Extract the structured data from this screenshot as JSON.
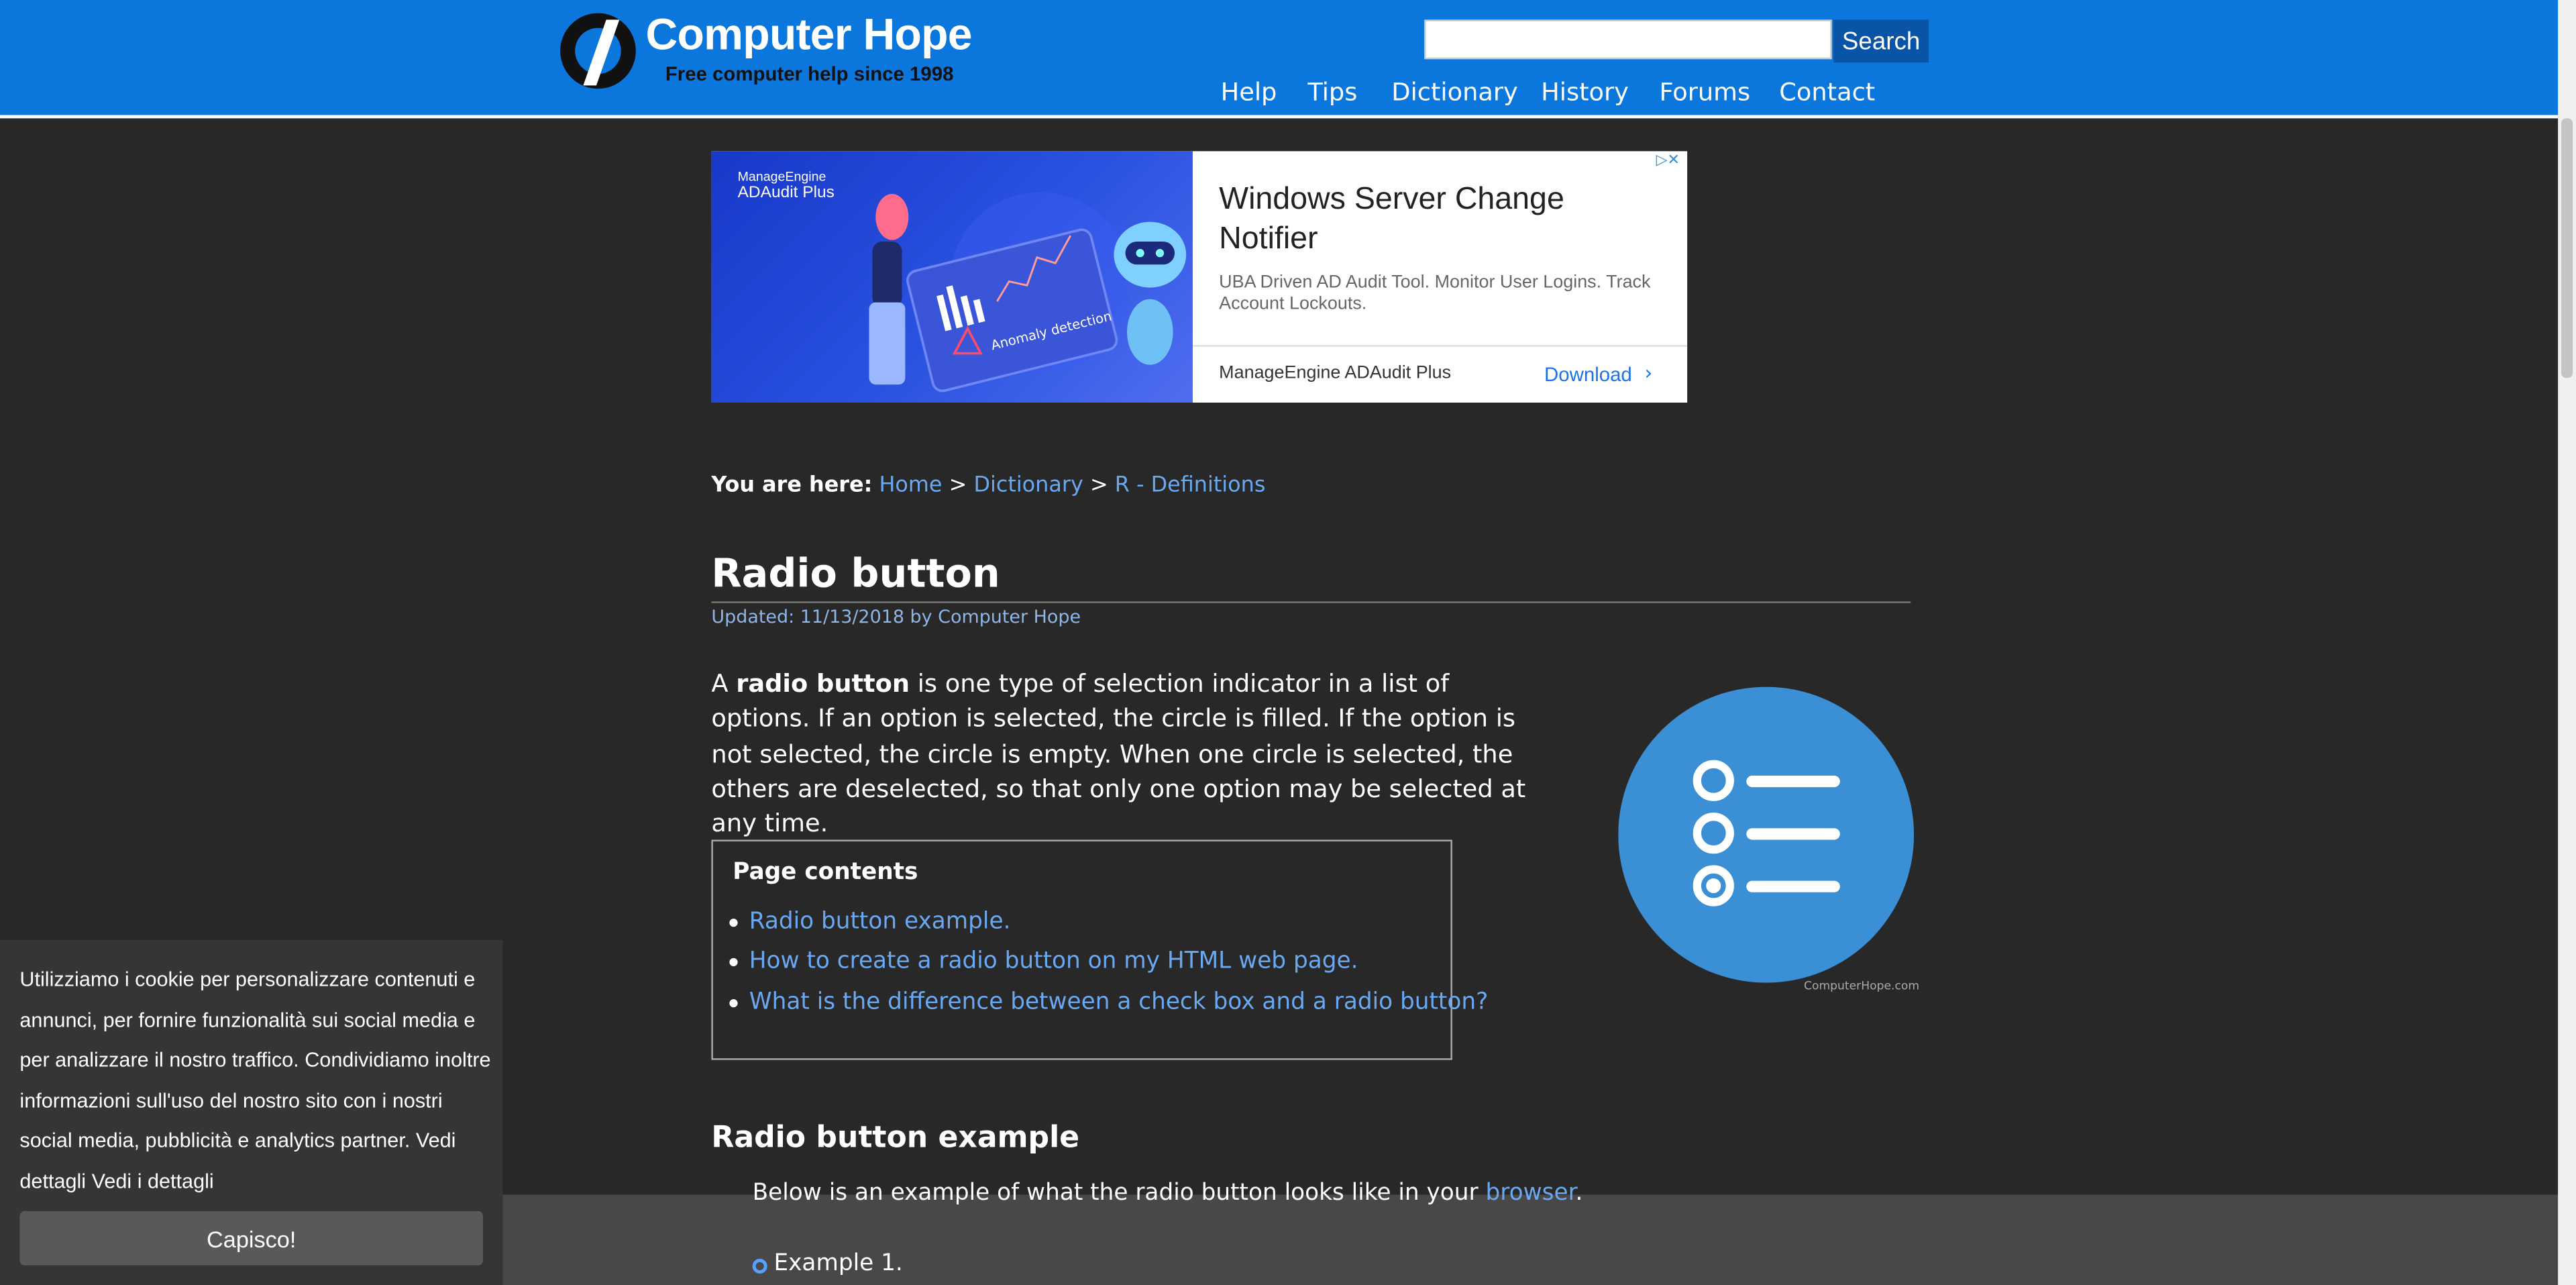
{
  "header": {
    "logo_title": "Computer Hope",
    "logo_tagline": "Free computer help since 1998",
    "search_value": "",
    "search_button": "Search",
    "nav": [
      "Help",
      "Tips",
      "Dictionary",
      "History",
      "Forums",
      "Contact"
    ]
  },
  "ad": {
    "brand_small": "ManageEngine",
    "brand_product": "ADAudit Plus",
    "image_caption": "Anomaly detection",
    "headline": "Windows Server Change Notifier",
    "body": "UBA Driven AD Audit Tool. Monitor User Logins. Track Account Lockouts.",
    "advertiser": "ManageEngine ADAudit Plus",
    "cta": "Download"
  },
  "breadcrumb": {
    "label": "You are here:",
    "items": [
      "Home",
      "Dictionary",
      "R - Definitions"
    ],
    "separator": ">"
  },
  "article": {
    "title": "Radio button",
    "updated": "Updated: 11/13/2018 by Computer Hope",
    "intro_a": "A ",
    "intro_bold": "radio button",
    "intro_b": " is one type of selection indicator in a list of options. If an option is selected, the circle is filled. If the option is not selected, the circle is empty. When one circle is selected, the others are deselected, so that only one option may be selected at any time.",
    "figure_caption": "ComputerHope.com",
    "toc_heading": "Page contents",
    "toc": [
      "Radio button example.",
      "How to create a radio button on my HTML web page.",
      "What is the difference between a check box and a radio button?"
    ],
    "section_heading": "Radio button example",
    "example_text_a": "Below is an example of what the radio button looks like in your ",
    "example_link": "browser",
    "example_text_b": ".",
    "example_label": "Example 1."
  },
  "cookie": {
    "text": "Utilizziamo i cookie per personalizzare contenuti e annunci, per fornire funzionalità sui social media e per analizzare il nostro traffico. Condividiamo inoltre informazioni sull'uso del nostro sito con i nostri social media, pubblicità e analytics partner. Vedi dettagli ",
    "link": "Vedi i dettagli",
    "button": "Capisco!"
  },
  "colors": {
    "header_bg": "#0b76dc",
    "page_bg": "#282828",
    "link": "#6aa8f2",
    "figure_blue": "#3b8fd4"
  }
}
